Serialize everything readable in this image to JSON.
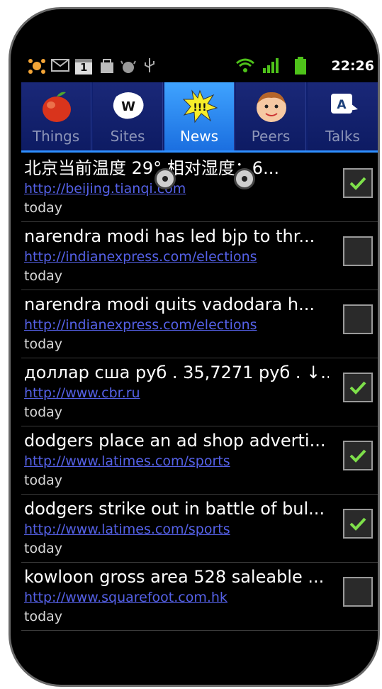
{
  "status_bar": {
    "time": "22:26",
    "icons": [
      "app-icon",
      "mail-icon",
      "calendar-icon",
      "bag-icon",
      "android-debug-icon",
      "usb-icon",
      "wifi-icon",
      "signal-icon",
      "battery-icon"
    ],
    "calendar_day": "1"
  },
  "tabs": [
    {
      "label": "Things",
      "icon": "apple-icon",
      "active": false
    },
    {
      "label": "Sites",
      "icon": "www-bubble-icon",
      "active": false
    },
    {
      "label": "News",
      "icon": "exclamation-burst-icon",
      "active": true
    },
    {
      "label": "Peers",
      "icon": "face-icon",
      "active": false
    },
    {
      "label": "Talks",
      "icon": "chat-bubble-icon",
      "active": false
    }
  ],
  "news": [
    {
      "title": "北京当前温度  29° 相对湿度：6...",
      "url": "http://beijing.tianqi.com",
      "time": "today",
      "checked": true
    },
    {
      "title": "narendra modi has led bjp to thr...",
      "url": "http://indianexpress.com/elections",
      "time": "today",
      "checked": false
    },
    {
      "title": "narendra modi quits vadodara h...",
      "url": "http://indianexpress.com/elections",
      "time": "today",
      "checked": false
    },
    {
      "title": "доллар сша руб . 35,7271 руб . ↓...",
      "url": "http://www.cbr.ru",
      "time": "today",
      "checked": true
    },
    {
      "title": "dodgers place an ad shop adverti...",
      "url": "http://www.latimes.com/sports",
      "time": "today",
      "checked": true
    },
    {
      "title": "dodgers strike out in battle of bul...",
      "url": "http://www.latimes.com/sports",
      "time": "today",
      "checked": true
    },
    {
      "title": "kowloon gross area 528 saleable ...",
      "url": "http://www.squarefoot.com.hk",
      "time": "today",
      "checked": false
    }
  ],
  "colors": {
    "link": "#5561e8",
    "check": "#7ee04a",
    "tab_active": "#3fa3ff",
    "tab_bg": "#0f1f6e"
  }
}
